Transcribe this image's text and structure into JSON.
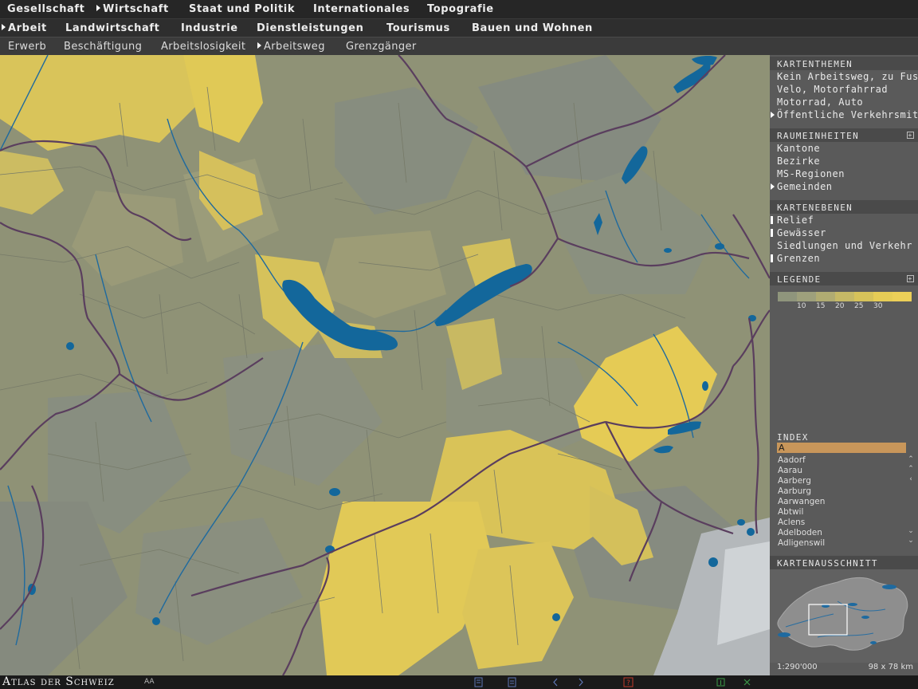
{
  "nav_main": [
    {
      "label": "Gesellschaft",
      "active": false
    },
    {
      "label": "Wirtschaft",
      "active": true
    },
    {
      "label": "Staat und Politik",
      "active": false
    },
    {
      "label": "Internationales",
      "active": false
    },
    {
      "label": "Topografie",
      "active": false
    }
  ],
  "nav_sub": [
    {
      "label": "Arbeit",
      "active": true
    },
    {
      "label": "Landwirtschaft",
      "active": false
    },
    {
      "label": "Industrie",
      "active": false
    },
    {
      "label": "Dienstleistungen",
      "active": false
    },
    {
      "label": "Tourismus",
      "active": false
    },
    {
      "label": "Bauen und Wohnen",
      "active": false
    }
  ],
  "nav_topic": [
    {
      "label": "Erwerb",
      "active": false
    },
    {
      "label": "Beschäftigung",
      "active": false
    },
    {
      "label": "Arbeitslosigkeit",
      "active": false
    },
    {
      "label": "Arbeitsweg",
      "active": true
    },
    {
      "label": "Grenzgänger",
      "active": false
    }
  ],
  "panel": {
    "kartenthemen": {
      "title": "KARTENTHEMEN",
      "items": [
        {
          "label": "Kein Arbeitsweg, zu Fuss",
          "active": false
        },
        {
          "label": "Velo, Motorfahrrad",
          "active": false
        },
        {
          "label": "Motorrad, Auto",
          "active": false
        },
        {
          "label": "Öffentliche Verkehrsmittel",
          "active": true
        }
      ]
    },
    "raumeinheiten": {
      "title": "RAUMEINHEITEN",
      "items": [
        {
          "label": "Kantone",
          "active": false
        },
        {
          "label": "Bezirke",
          "active": false
        },
        {
          "label": "MS-Regionen",
          "active": false
        },
        {
          "label": "Gemeinden",
          "active": true
        }
      ]
    },
    "kartenebenen": {
      "title": "KARTENEBENEN",
      "items": [
        {
          "label": "Relief",
          "checked": true
        },
        {
          "label": "Gewässer",
          "checked": true
        },
        {
          "label": "Siedlungen und Verkehr",
          "checked": false
        },
        {
          "label": "Grenzen",
          "checked": true
        }
      ]
    },
    "legende": {
      "title": "LEGENDE",
      "colors": [
        "#8f957c",
        "#9ea07c",
        "#b0ab72",
        "#c5b866",
        "#d6c25a",
        "#e6cc56",
        "#eccf58"
      ],
      "ticks": [
        "10",
        "15",
        "20",
        "25",
        "30"
      ]
    },
    "index": {
      "title": "INDEX",
      "selected": "A",
      "items": [
        "Aadorf",
        "Aarau",
        "Aarberg",
        "Aarburg",
        "Aarwangen",
        "Abtwil",
        "Aclens",
        "Adelboden",
        "Adligenswil"
      ]
    },
    "kartenausschnitt": {
      "title": "KARTENAUSSCHNITT",
      "scale": "1:290'000",
      "extent": "98 x 78 km"
    }
  },
  "footer": {
    "brand": "Atlas der Schweiz",
    "brand_sub": "AA"
  },
  "colors": {
    "water": "#13679b",
    "border": "#5a3e5e",
    "yellow": "#e2c955",
    "base": "#8f9276"
  }
}
